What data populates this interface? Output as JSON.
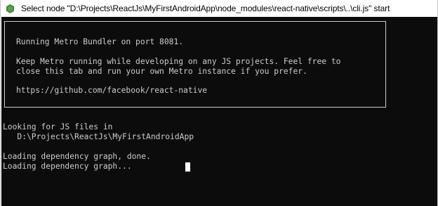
{
  "window": {
    "title": "Select node  \"D:\\Projects\\ReactJs\\MyFirstAndroidApp\\node_modules\\react-native\\scripts\\..\\cli.js\" start",
    "icon": "node-app-icon",
    "colors": {
      "console_bg": "#0c0c0c",
      "console_text": "#cccccc",
      "icon_green": "#3c873a"
    }
  },
  "banner": {
    "line1": "Running Metro Bundler on port 8081.",
    "line2": "Keep Metro running while developing on any JS projects. Feel free to",
    "line3": "close this tab and run your own Metro instance if you prefer.",
    "line4": "https://github.com/facebook/react-native"
  },
  "output": {
    "line1": "Looking for JS files in",
    "line2": "   D:\\Projects\\ReactJs\\MyFirstAndroidApp",
    "line3": "Loading dependency graph, done.",
    "line4": "Loading dependency graph..."
  }
}
